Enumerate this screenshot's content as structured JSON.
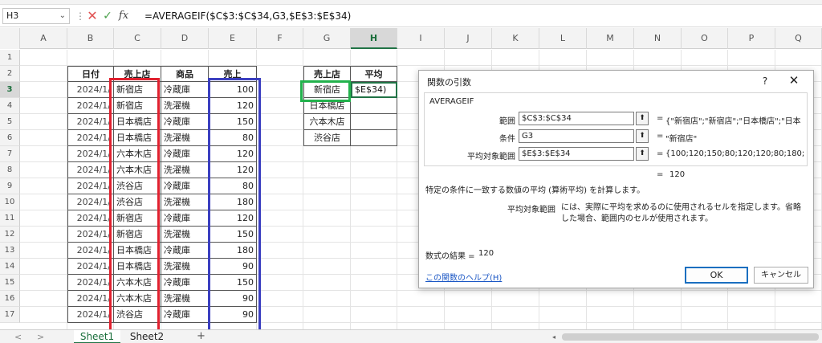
{
  "formula_bar": {
    "name_box": "H3",
    "formula": "=AVERAGEIF($C$3:$C$34,G3,$E$3:$E$34)"
  },
  "columns": [
    "A",
    "B",
    "C",
    "D",
    "E",
    "F",
    "G",
    "H",
    "I",
    "J",
    "K",
    "L",
    "M",
    "N",
    "O",
    "P",
    "Q"
  ],
  "rows": [
    "1",
    "2",
    "3",
    "4",
    "5",
    "6",
    "7",
    "8",
    "9",
    "10",
    "11",
    "12",
    "13",
    "14",
    "15",
    "16",
    "17"
  ],
  "active_cell": {
    "column": "H",
    "row": "3"
  },
  "sales_table": {
    "headers": [
      "日付",
      "売上店",
      "商品",
      "売上"
    ],
    "rows": [
      {
        "date": "2024/1/",
        "store": "新宿店",
        "product": "冷蔵庫",
        "sales": "100"
      },
      {
        "date": "2024/1/",
        "store": "新宿店",
        "product": "洗濯機",
        "sales": "120"
      },
      {
        "date": "2024/1/",
        "store": "日本橋店",
        "product": "冷蔵庫",
        "sales": "150"
      },
      {
        "date": "2024/1/",
        "store": "日本橋店",
        "product": "洗濯機",
        "sales": "80"
      },
      {
        "date": "2024/1/",
        "store": "六本木店",
        "product": "冷蔵庫",
        "sales": "120"
      },
      {
        "date": "2024/1/",
        "store": "六本木店",
        "product": "洗濯機",
        "sales": "120"
      },
      {
        "date": "2024/1/",
        "store": "渋谷店",
        "product": "冷蔵庫",
        "sales": "80"
      },
      {
        "date": "2024/1/",
        "store": "渋谷店",
        "product": "洗濯機",
        "sales": "180"
      },
      {
        "date": "2024/1/",
        "store": "新宿店",
        "product": "冷蔵庫",
        "sales": "120"
      },
      {
        "date": "2024/1/",
        "store": "新宿店",
        "product": "洗濯機",
        "sales": "150"
      },
      {
        "date": "2024/1/",
        "store": "日本橋店",
        "product": "冷蔵庫",
        "sales": "180"
      },
      {
        "date": "2024/1/",
        "store": "日本橋店",
        "product": "洗濯機",
        "sales": "90"
      },
      {
        "date": "2024/1/",
        "store": "六本木店",
        "product": "冷蔵庫",
        "sales": "150"
      },
      {
        "date": "2024/1/",
        "store": "六本木店",
        "product": "洗濯機",
        "sales": "90"
      },
      {
        "date": "2024/1/",
        "store": "渋谷店",
        "product": "冷蔵庫",
        "sales": "90"
      }
    ]
  },
  "summary_table": {
    "headers": [
      "売上店",
      "平均"
    ],
    "stores": [
      "新宿店",
      "日本橋店",
      "六本木店",
      "渋谷店"
    ],
    "editing_value": "$E$34)"
  },
  "dialog": {
    "title": "関数の引数",
    "help": "?",
    "close": "✕",
    "function_name": "AVERAGEIF",
    "args": [
      {
        "label": "範囲",
        "value": "$C$3:$C$34",
        "preview": "{\"新宿店\";\"新宿店\";\"日本橋店\";\"日本"
      },
      {
        "label": "条件",
        "value": "G3",
        "preview": "\"新宿店\""
      },
      {
        "label": "平均対象範囲",
        "value": "$E$3:$E$34",
        "preview": "{100;120;150;80;120;120;80;180;"
      }
    ],
    "result_preview": "120",
    "description": "特定の条件に一致する数値の平均 (算術平均) を計算します。",
    "arg_help_name": "平均対象範囲",
    "arg_help_text": "には、実際に平均を求めるのに使用されるセルを指定します。省略した場合、範囲内のセルが使用されます。",
    "result_label": "数式の結果 =",
    "result_value": "120",
    "help_link": "この関数のヘルプ(H)",
    "ok_label": "OK",
    "cancel_label": "キャンセル"
  },
  "sheets": {
    "tabs": [
      "Sheet1",
      "Sheet2"
    ],
    "active": "Sheet1",
    "add": "+"
  },
  "colors": {
    "red_box": "#e0202e",
    "green_box": "#22b24c",
    "blue_box": "#3b3fc0",
    "excel_green": "#217346"
  }
}
